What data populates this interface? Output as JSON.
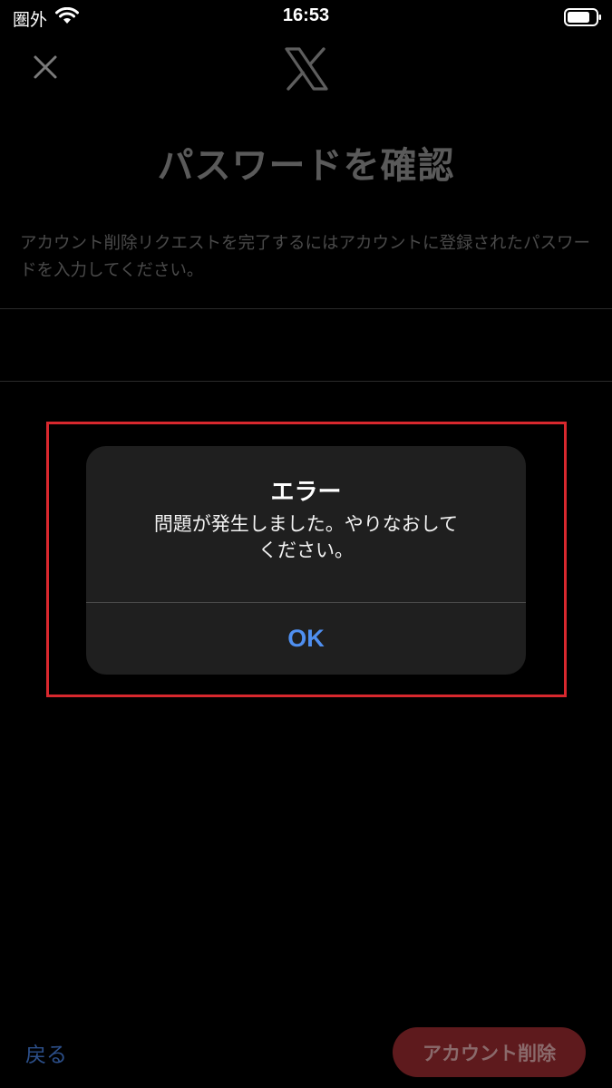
{
  "status_bar": {
    "carrier": "圏外",
    "time": "16:53",
    "wifi_icon": "wifi-icon",
    "battery_icon": "battery-icon"
  },
  "header": {
    "close_icon": "close-icon",
    "logo_icon": "x-logo-icon"
  },
  "page": {
    "title": "パスワードを確認",
    "description": "アカウント削除リクエストを完了するにはアカウントに登録されたパスワードを入力してください。",
    "password_value": ""
  },
  "alert": {
    "title": "エラー",
    "message_line1": "問題が発生しました。やりなおして",
    "message_line2": "ください。",
    "ok_label": "OK"
  },
  "footer": {
    "back_label": "戻る",
    "delete_label": "アカウント削除"
  },
  "colors": {
    "background": "#000000",
    "alert_bg": "#1f1f1f",
    "ok_blue": "#4f8ff0",
    "highlight_red": "#d8282e",
    "delete_bg": "#5e1a1d"
  }
}
